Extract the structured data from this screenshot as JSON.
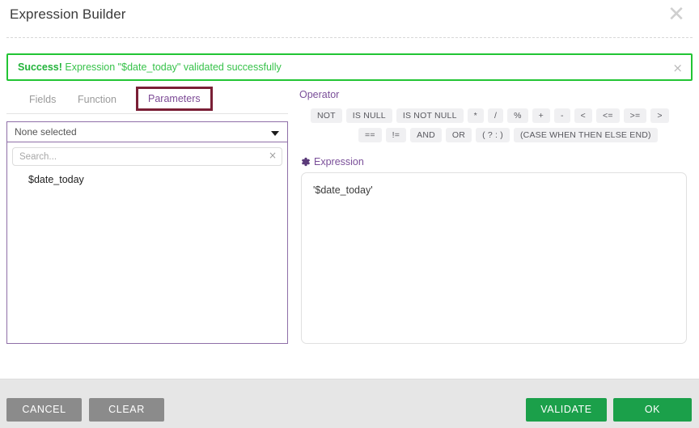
{
  "dialog": {
    "title": "Expression Builder",
    "close_icon": "close-icon"
  },
  "alert": {
    "status": "Success!",
    "message": " Expression \"$date_today\" validated successfully",
    "close_label": "×",
    "border_color": "#22c534",
    "text_color": "#37c24a"
  },
  "tabs": {
    "items": [
      {
        "label": "Fields",
        "selected": false
      },
      {
        "label": "Function",
        "selected": false
      },
      {
        "label": "Parameters",
        "selected": true
      }
    ],
    "selected_border_color": "#7a1f36",
    "selected_text_color": "#7d4b96"
  },
  "left_panel": {
    "select_value": "None selected",
    "caret_icon": "chevron-down-icon",
    "search_placeholder": "Search...",
    "search_value": "",
    "search_clear_label": "×",
    "items": [
      {
        "label": "$date_today"
      }
    ],
    "border_color": "#8f6fa8"
  },
  "right_panel": {
    "operator_label": "Operator",
    "expression_label": "Expression",
    "gear_icon": "gear-icon",
    "operator_rows": [
      [
        "NOT",
        "IS NULL",
        "IS NOT NULL",
        "*",
        "/",
        "%",
        "+",
        "-",
        "<",
        "<=",
        ">=",
        ">"
      ],
      [
        "==",
        "!=",
        "AND",
        "OR",
        "( ? : )",
        "(CASE WHEN THEN ELSE END)"
      ]
    ],
    "expression_value": "'$date_today'",
    "expression_placeholder": "",
    "label_color": "#7a4f99"
  },
  "footer": {
    "cancel_label": "CANCEL",
    "clear_label": "CLEAR",
    "validate_label": "VALIDATE",
    "ok_label": "OK",
    "grey_color": "#8b8b8b",
    "green_color": "#1ba04a"
  }
}
